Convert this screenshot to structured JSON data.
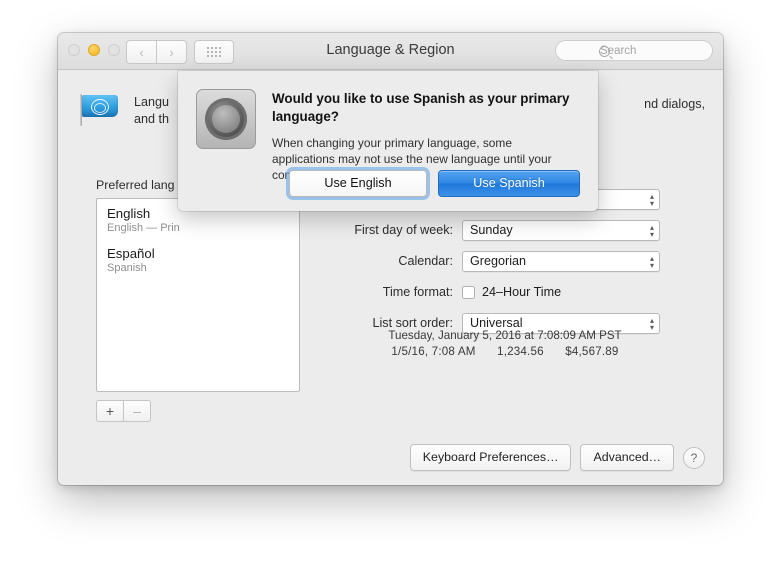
{
  "window": {
    "title": "Language & Region",
    "traffic_lights": [
      "close",
      "minimize",
      "maximize"
    ],
    "nav": {
      "back": "‹",
      "forward": "›",
      "show_all": "show-all-grid"
    },
    "search": {
      "placeholder": "Search",
      "value": ""
    }
  },
  "intro": {
    "line1": "Langu",
    "line2": "and th",
    "tail": "nd dialogs,",
    "icon": "un-flag-icon"
  },
  "languages": {
    "label": "Preferred lang",
    "items": [
      {
        "name": "English",
        "detail": "English — Prin"
      },
      {
        "name": "Español",
        "detail": "Spanish"
      }
    ],
    "add_button": "+",
    "remove_button": "–"
  },
  "form": {
    "fields": [
      {
        "label": "",
        "value": "",
        "type": "select",
        "hidden_by_sheet": true
      },
      {
        "label": "First day of week:",
        "value": "Sunday",
        "type": "select"
      },
      {
        "label": "Calendar:",
        "value": "Gregorian",
        "type": "select"
      },
      {
        "label": "Time format:",
        "value": "24–Hour Time",
        "type": "checkbox",
        "checked": false
      },
      {
        "label": "List sort order:",
        "value": "Universal",
        "type": "select"
      }
    ]
  },
  "preview": {
    "line1": "Tuesday, January 5, 2016 at 7:08:09 AM PST",
    "line2_date": "1/5/16, 7:08 AM",
    "line2_number": "1,234.56",
    "line2_currency": "$4,567.89"
  },
  "footer": {
    "keyboard_preferences": "Keyboard Preferences…",
    "advanced": "Advanced…",
    "help": "?"
  },
  "sheet": {
    "icon": "system-preferences-gear-icon",
    "title": "Would you like to use Spanish as your primary language?",
    "message": "When changing your primary language, some applications may not use the new language until your computer is restarted.",
    "alt_button": "Use English",
    "default_button": "Use Spanish"
  },
  "colors": {
    "accent_blue": "#2f87e4",
    "focus_ring": "#5aa0eb",
    "window_bg": "#ececec",
    "minimize_yellow": "#f5bc30"
  }
}
